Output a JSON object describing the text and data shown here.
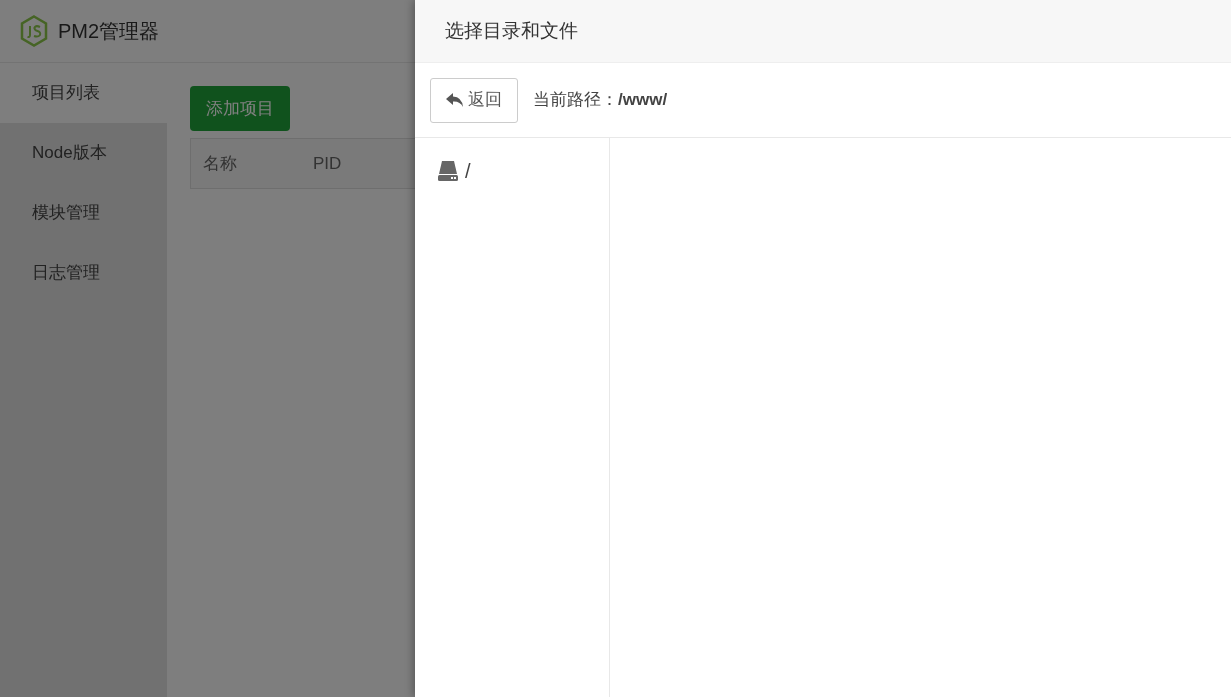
{
  "app": {
    "title": "PM2管理器"
  },
  "sidebar": {
    "items": [
      {
        "label": "项目列表",
        "selected": true
      },
      {
        "label": "Node版本",
        "selected": false
      },
      {
        "label": "模块管理",
        "selected": false
      },
      {
        "label": "日志管理",
        "selected": false
      }
    ]
  },
  "content": {
    "add_button": "添加项目",
    "table": {
      "columns": [
        "名称",
        "PID"
      ]
    }
  },
  "drawer": {
    "title": "选择目录和文件",
    "back_button": "返回",
    "path_label": "当前路径：",
    "path_value": "/www/",
    "tree": [
      {
        "label": "/"
      }
    ]
  }
}
